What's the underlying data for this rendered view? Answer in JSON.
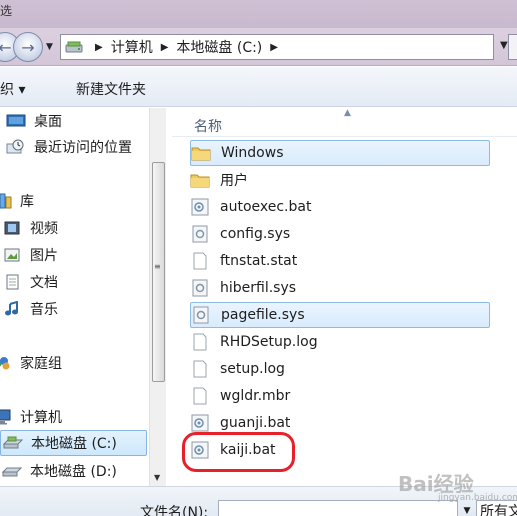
{
  "window": {
    "title_fragment": "选"
  },
  "address": {
    "crumbs": [
      "计算机",
      "本地磁盘 (C:)"
    ]
  },
  "toolbar": {
    "organize_label": "组织 ▾",
    "new_folder_label": "新建文件夹"
  },
  "nav": {
    "items": [
      {
        "label": "桌面",
        "icon": "desktop-icon"
      },
      {
        "label": "最近访问的位置",
        "icon": "recent-places-icon"
      },
      {
        "label": "库",
        "icon": "library-icon"
      },
      {
        "label": "视频",
        "icon": "video-library-icon"
      },
      {
        "label": "图片",
        "icon": "pictures-library-icon"
      },
      {
        "label": "文档",
        "icon": "documents-library-icon"
      },
      {
        "label": "音乐",
        "icon": "music-library-icon"
      },
      {
        "label": "家庭组",
        "icon": "homegroup-icon"
      },
      {
        "label": "计算机",
        "icon": "computer-icon"
      },
      {
        "label": "本地磁盘 (C:)",
        "icon": "drive-icon",
        "selected": true
      },
      {
        "label": "本地磁盘 (D:)",
        "icon": "drive-icon"
      }
    ]
  },
  "files": {
    "column_header": "名称",
    "items": [
      {
        "name": "Windows",
        "type": "folder",
        "selected": true
      },
      {
        "name": "用户",
        "type": "folder"
      },
      {
        "name": "autoexec.bat",
        "type": "bat"
      },
      {
        "name": "config.sys",
        "type": "sys"
      },
      {
        "name": "ftnstat.stat",
        "type": "file"
      },
      {
        "name": "hiberfil.sys",
        "type": "sys"
      },
      {
        "name": "pagefile.sys",
        "type": "sys",
        "selected": true
      },
      {
        "name": "RHDSetup.log",
        "type": "file"
      },
      {
        "name": "setup.log",
        "type": "file"
      },
      {
        "name": "wgldr.mbr",
        "type": "file"
      },
      {
        "name": "guanji.bat",
        "type": "bat"
      },
      {
        "name": "kaiji.bat",
        "type": "bat",
        "highlighted": true
      }
    ]
  },
  "bottom": {
    "filename_label": "文件名(N):",
    "filename_value": "",
    "type_value": "所有文"
  },
  "watermark": {
    "text": "Bai经验",
    "sub": "jingyan.baidu.com"
  },
  "colors": {
    "highlight_circle": "#e8202a",
    "selection": "#cde8fc"
  }
}
